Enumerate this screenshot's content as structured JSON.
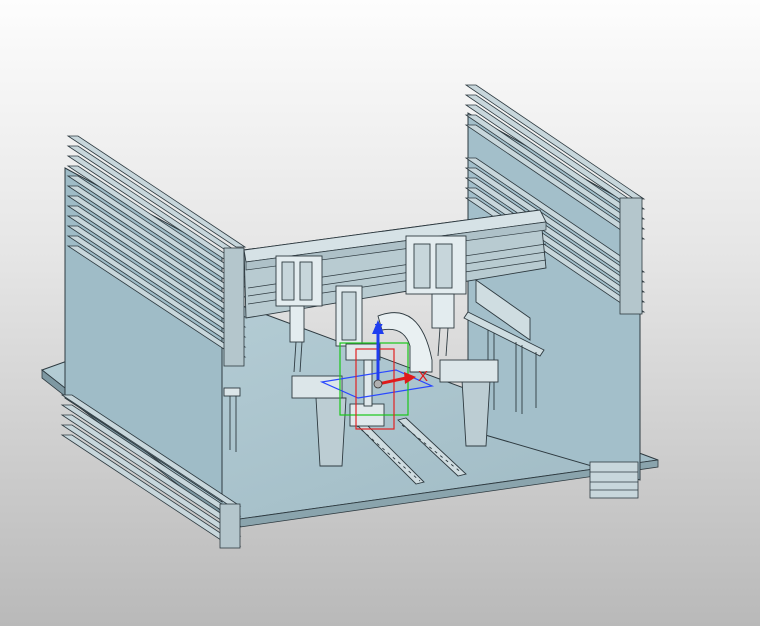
{
  "viewport": {
    "background_top": "#fdfdfd",
    "background_bottom": "#b9b9b9"
  },
  "model": {
    "base_plate_color": "#a9c4ce",
    "panel_color": "#9fbcc7",
    "extrusion_color": "#c8d7dc",
    "edge_color": "#2e3a40"
  },
  "triad": {
    "z_label": "Z",
    "x_label": "X",
    "z_color": "#1f3df0",
    "x_color": "#e01a1a",
    "plane_colors": [
      "#2a48ff",
      "#19c719",
      "#e22222"
    ]
  }
}
